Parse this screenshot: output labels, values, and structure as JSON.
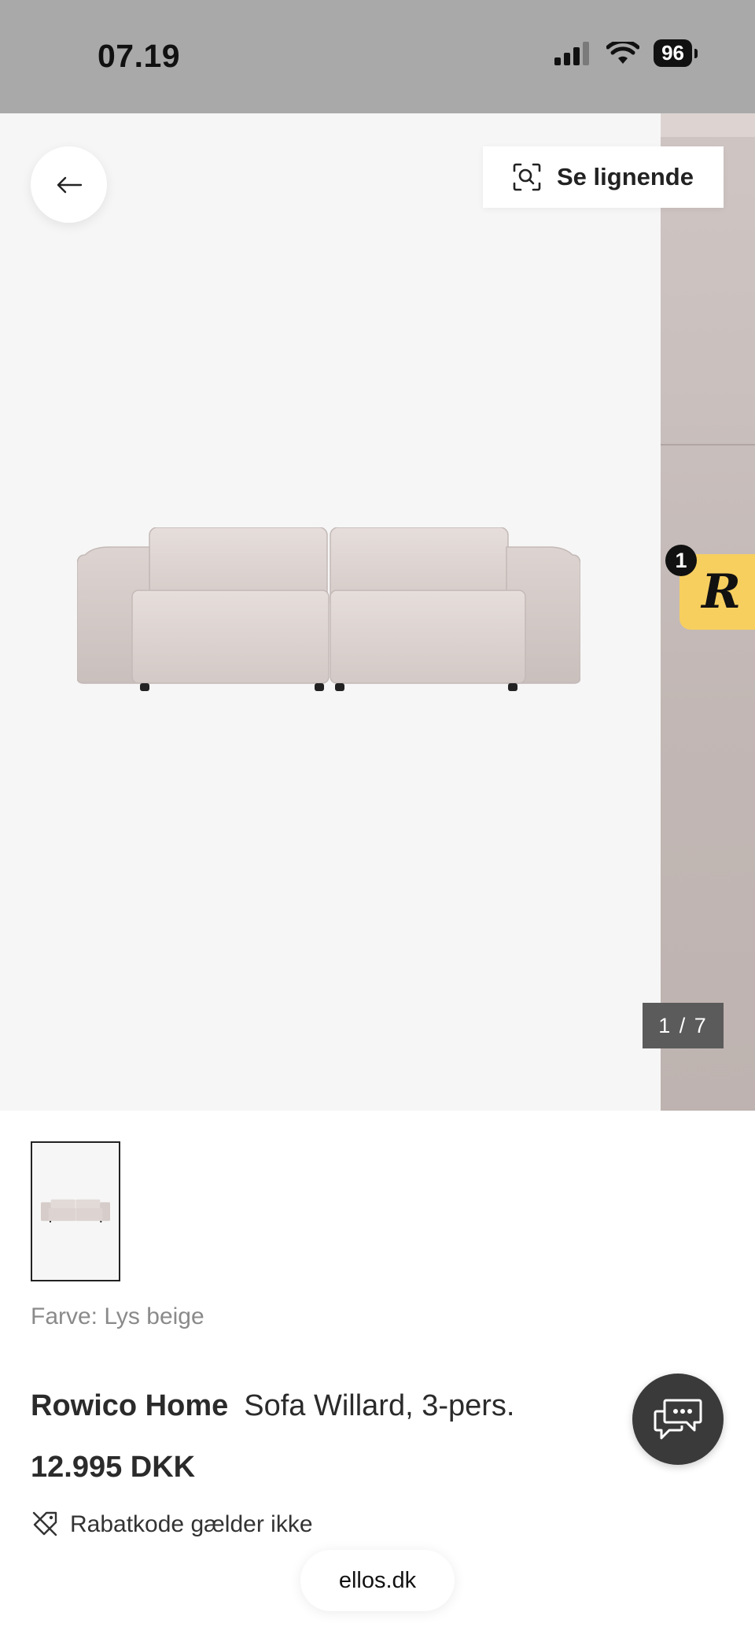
{
  "status_bar": {
    "time": "07.19",
    "battery": "96",
    "icons": [
      "signal-icon",
      "wifi-icon",
      "battery-icon"
    ]
  },
  "gallery": {
    "similar_button_label": "Se lignende",
    "counter": "1 / 7",
    "badge_count": "1",
    "badge_letter": "R"
  },
  "product": {
    "color_label": "Farve: Lys beige",
    "brand": "Rowico Home",
    "name": "Sofa Willard, 3-pers.",
    "price": "12.995 DKK",
    "discount_note": "Rabatkode gælder ikke"
  },
  "browser": {
    "url": "ellos.dk"
  },
  "colors": {
    "status_bar_bg": "#a9a9a9",
    "gallery_bg": "#f6f6f6",
    "badge_yellow": "#f7cf5f",
    "chat_button_bg": "#3a3a3a",
    "counter_bg": "#5b5b5b"
  }
}
